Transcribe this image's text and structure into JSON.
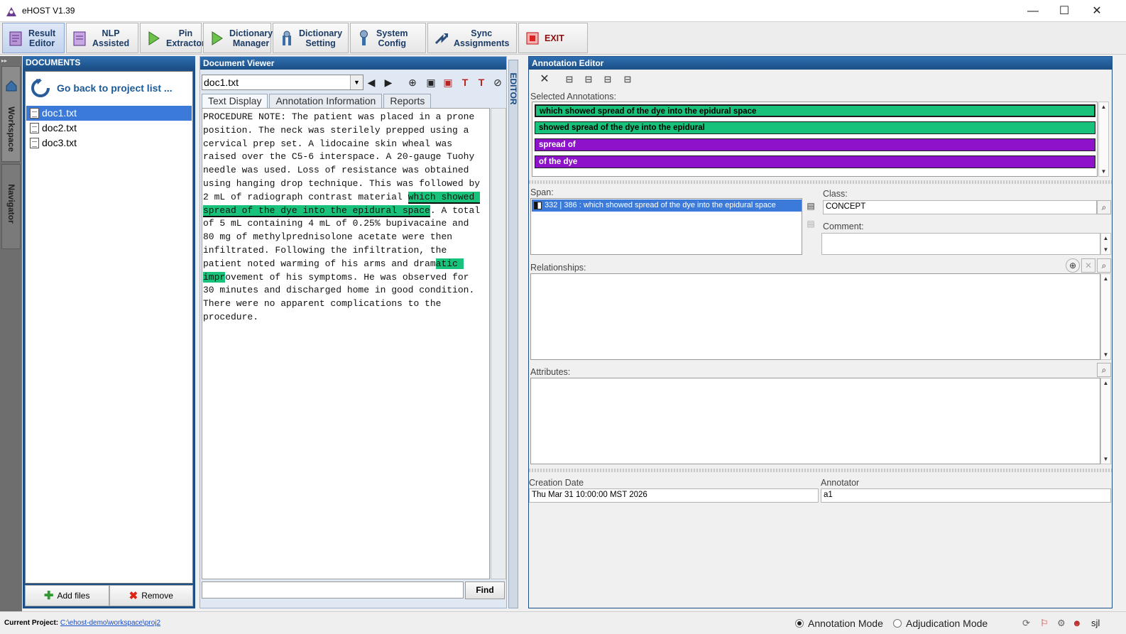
{
  "window": {
    "title": "eHOST V1.39",
    "minimize": "—",
    "maximize": "☐",
    "close": "✕"
  },
  "toolbar": {
    "buttons": [
      {
        "label": "Result\nEditor",
        "active": true
      },
      {
        "label": "NLP\nAssisted"
      },
      {
        "label": "Pin\nExtractor"
      },
      {
        "label": "Dictionary\nManager"
      },
      {
        "label": "Dictionary\nSetting"
      },
      {
        "label": "System\nConfig"
      },
      {
        "label": "Sync\nAssignments"
      },
      {
        "label": "EXIT"
      }
    ]
  },
  "sidetabs": {
    "workspace": "Workspace",
    "navigator": "Navigator"
  },
  "documents": {
    "header": "DOCUMENTS",
    "go_back": "Go back to project list ...",
    "files": [
      "doc1.txt",
      "doc2.txt",
      "doc3.txt"
    ],
    "selected_index": 0,
    "add_files": "Add files",
    "remove": "Remove"
  },
  "viewer": {
    "header": "Document Viewer",
    "current_doc": "doc1.txt",
    "tabs": [
      "Text Display",
      "Annotation Information",
      "Reports"
    ],
    "text_lines": [
      "PROCEDURE NOTE: The patient was placed in a prone",
      "position. The neck was sterilely prepped using a",
      "cervical prep set. A lidocaine skin wheal was",
      "raised over the C5-6 interspace. A 20-gauge Tuohy",
      "needle was used. Loss of resistance was obtained",
      "using hanging drop technique. This was followed by",
      "2 mL of radiograph contrast material ",
      "which showed ",
      "spread of the dye into the epidural space",
      ". A total",
      "of 5 mL containing 4 mL of 0.25% bupivacaine and",
      "80 mg of methylprednisolone acetate were then",
      "infiltrated. Following the infiltration, the",
      "patient noted warming of his arms and dram",
      "atic ",
      "impr",
      "ovement of his symptoms. He was observed for",
      "30 minutes and discharged home in good condition.",
      "There were no apparent complications to the",
      "procedure."
    ],
    "find_label": "Find",
    "find_value": ""
  },
  "editor_tab": "EDITOR",
  "annotation_editor": {
    "header": "Annotation Editor",
    "selected_label": "Selected Annotations:",
    "selected": [
      {
        "text": "which showed spread of the dye into the epidural space",
        "color": "#19c27a"
      },
      {
        "text": "showed spread of the dye into the epidural",
        "color": "#19c27a"
      },
      {
        "text": "spread of",
        "color": "#8d12c9"
      },
      {
        "text": "of the dye",
        "color": "#8d12c9"
      }
    ],
    "span_label": "Span:",
    "span_item": "332 | 386 : which showed spread of the dye into the epidural space",
    "class_label": "Class:",
    "class_value": "CONCEPT",
    "comment_label": "Comment:",
    "comment_value": "",
    "relationships_label": "Relationships:",
    "attributes_label": "Attributes:",
    "creation_date_label": "Creation Date",
    "creation_date": "Thu Mar 31 10:00:00 MST 2026",
    "annotator_label": "Annotator",
    "annotator": "a1"
  },
  "status": {
    "current_project_label": "Current Project:",
    "current_project_path": "C:\\ehost-demo\\workspace\\proj2",
    "annotation_mode": "Annotation Mode",
    "adjudication_mode": "Adjudication Mode",
    "mode_selected": "annotation",
    "user": "sjl"
  },
  "colors": {
    "accent": "#1b4f86",
    "selection": "#3b7ad9",
    "annotation_green": "#19c27a",
    "annotation_purple": "#8d12c9"
  }
}
